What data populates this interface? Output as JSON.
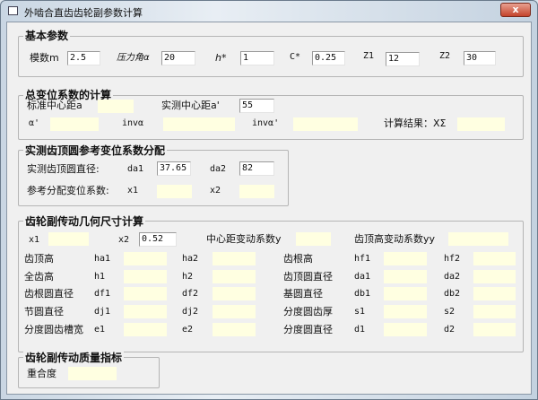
{
  "window": {
    "title": "外啮合直齿齿轮副参数计算",
    "close": "x"
  },
  "basic": {
    "title": "基本参数",
    "m_label": "模数m",
    "m": "2.5",
    "alpha_label": "压力角α",
    "alpha": "20",
    "ha_label": "h*",
    "ha": "1",
    "c_label": "C*",
    "c": "0.25",
    "z1_label": "Z1",
    "z1": "12",
    "z2_label": "Z2",
    "z2": "30"
  },
  "total": {
    "title": "总变位系数的计算",
    "a_label": "标准中心距a",
    "a_measured_label": "实测中心距a'",
    "a_measured": "55",
    "alpha_p_label": "α'",
    "inv_alpha_label": "invα",
    "inv_alpha_p_label": "invα'",
    "result_label": "计算结果：XΣ"
  },
  "tip": {
    "title": "实测齿顶圆参考变位系数分配",
    "da_label": "实测齿顶圆直径:",
    "da1_label": "da1",
    "da1": "37.65",
    "da2_label": "da2",
    "da2": "82",
    "x_label": "参考分配变位系数:",
    "x1_label": "x1",
    "x2_label": "x2"
  },
  "geom": {
    "title": "齿轮副传动几何尺寸计算",
    "x1_label": "x1",
    "x2_label": "x2",
    "x2": "0.52",
    "y_label": "中心距变动系数y",
    "yy_label": "齿顶高变动系数yy",
    "rows": [
      {
        "l": "齿顶高",
        "a": "ha1",
        "b": "ha2",
        "l2": "齿根高",
        "c": "hf1",
        "d": "hf2"
      },
      {
        "l": "全齿高",
        "a": "h1",
        "b": "h2",
        "l2": "齿顶圆直径",
        "c": "da1",
        "d": "da2"
      },
      {
        "l": "齿根圆直径",
        "a": "df1",
        "b": "df2",
        "l2": "基圆直径",
        "c": "db1",
        "d": "db2"
      },
      {
        "l": "节圆直径",
        "a": "dj1",
        "b": "dj2",
        "l2": "分度圆齿厚",
        "c": "s1",
        "d": "s2"
      },
      {
        "l": "分度圆齿槽宽",
        "a": "e1",
        "b": "e2",
        "l2": "分度圆直径",
        "c": "d1",
        "d": "d2"
      }
    ]
  },
  "quality": {
    "title": "齿轮副传动质量指标",
    "overlap_label": "重合度"
  }
}
